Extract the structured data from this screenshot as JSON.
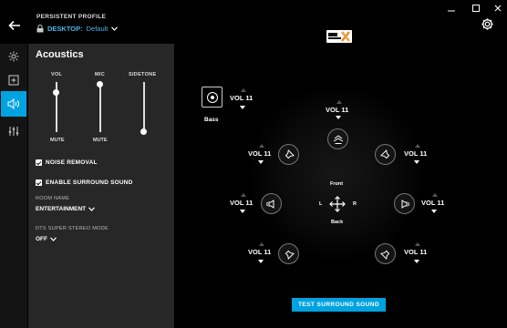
{
  "header": {
    "profile_caption": "PERSISTENT PROFILE",
    "profile_name": "DESKTOP",
    "profile_sep": ":",
    "profile_value": "Default"
  },
  "brand": {
    "logo_text": "dts headphone X"
  },
  "rail": {
    "items": [
      "lighting",
      "add",
      "acoustics",
      "equalizer"
    ],
    "active": "acoustics"
  },
  "panel": {
    "title": "Acoustics",
    "sliders": [
      {
        "label": "VOL",
        "level": 0.82,
        "footer": "MUTE"
      },
      {
        "label": "MIC",
        "level": 1.0,
        "footer": "MUTE"
      },
      {
        "label": "SIDETONE",
        "level": 0.0,
        "footer": ""
      }
    ],
    "noise_removal": {
      "label": "NOISE REMOVAL",
      "checked": true
    },
    "surround": {
      "label": "ENABLE SURROUND SOUND",
      "checked": true
    },
    "room_name": {
      "label": "ROOM NAME",
      "value": "ENTERTAINMENT"
    },
    "dts_mode": {
      "label": "DTS SUPER STEREO MODE",
      "value": "OFF"
    }
  },
  "surround": {
    "bass": {
      "label": "Bass",
      "vol": "VOL 11"
    },
    "speakers": {
      "center": "VOL 11",
      "front_left": "VOL 11",
      "front_right": "VOL 11",
      "side_left": "VOL 11",
      "side_right": "VOL 11",
      "rear_left": "VOL 11",
      "rear_right": "VOL 11"
    },
    "directions": {
      "front": "Front",
      "back": "Back",
      "left": "L",
      "right": "R"
    },
    "test_button": "TEST SURROUND SOUND"
  },
  "colors": {
    "accent": "#00a3e0",
    "panel": "#272727",
    "rail": "#141414",
    "background": "#000000"
  }
}
